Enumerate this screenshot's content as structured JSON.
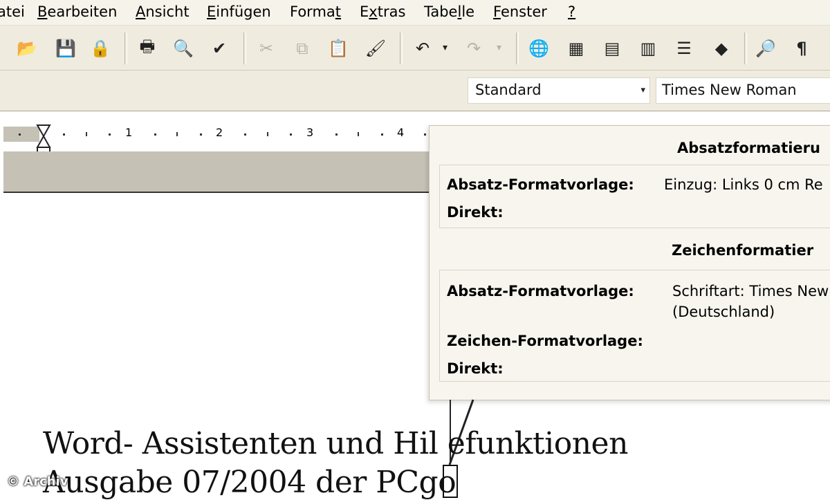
{
  "menubar": {
    "items": [
      {
        "pre": "",
        "accel": "",
        "post": "atei"
      },
      {
        "pre": "",
        "accel": "B",
        "post": "earbeiten"
      },
      {
        "pre": "",
        "accel": "A",
        "post": "nsicht"
      },
      {
        "pre": "",
        "accel": "E",
        "post": "infügen"
      },
      {
        "pre": "Forma",
        "accel": "t",
        "post": ""
      },
      {
        "pre": "E",
        "accel": "x",
        "post": "tras"
      },
      {
        "pre": "Tabe",
        "accel": "l",
        "post": "le"
      },
      {
        "pre": "",
        "accel": "F",
        "post": "enster"
      },
      {
        "pre": "",
        "accel": "?",
        "post": ""
      }
    ]
  },
  "toolbar": {
    "icons": {
      "open": "📂",
      "save": "💾",
      "permission": "🔒",
      "print": "🖶",
      "preview": "🔍",
      "spell": "✔",
      "cut": "✂",
      "copy": "⧉",
      "paste": "📋",
      "format_painter": "🖌",
      "undo": "↶",
      "redo": "↷",
      "dropdown": "▾",
      "hyperlink": "🌐",
      "tables_borders": "▦",
      "insert_table": "▤",
      "insert_excel": "▥",
      "columns": "☰",
      "drawing": "◆",
      "doc_map": "🔎",
      "pilcrow": "¶"
    }
  },
  "formatting": {
    "style": "Standard",
    "font": "Times New Roman",
    "dropdown_icon": "▾"
  },
  "ruler": {
    "numbers": [
      "1",
      "2",
      "3",
      "4"
    ]
  },
  "reveal": {
    "paragraph_heading": "Absatzformatieru",
    "paragraph": {
      "style_label": "Absatz-Formatvorlage:",
      "style_value": "Einzug:  Links  0 cm Re",
      "direct_label": "Direkt:"
    },
    "character_heading": "Zeichenformatier",
    "character": {
      "style_label": "Absatz-Formatvorlage:",
      "style_value_line1": "Schriftart: Times New",
      "style_value_line2": "(Deutschland)",
      "char_style_label": "Zeichen-Formatvorlage:",
      "direct_label": "Direkt:"
    }
  },
  "document": {
    "line1": "Word- Assistenten und Hil efunktionen",
    "line2": "Ausgabe 07/2004 der PCgo"
  },
  "watermark": "© Archiv",
  "colors": {
    "toolbar_bg": "#efebde",
    "ruler_gray": "#c5c1b5",
    "panel_bg": "#f7f5ee"
  }
}
